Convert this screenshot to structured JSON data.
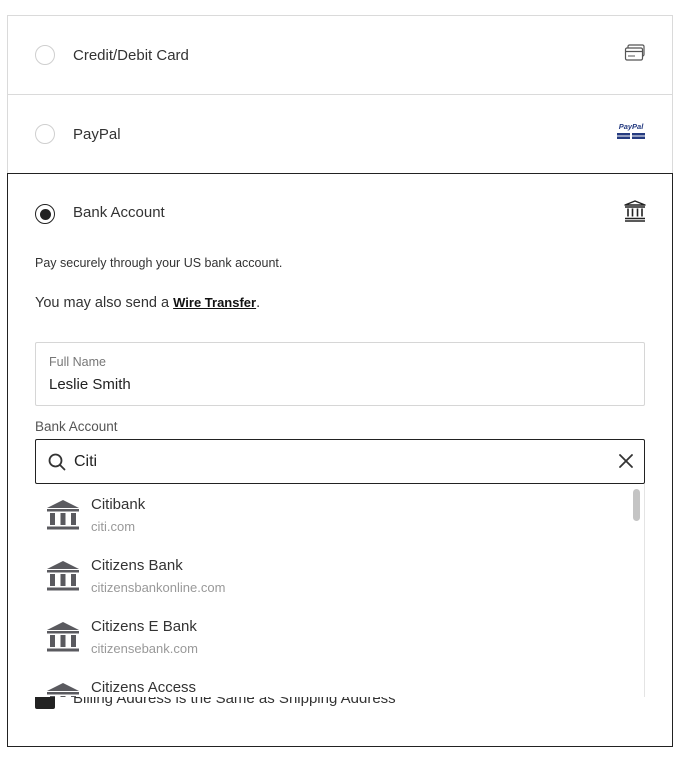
{
  "payment_options": {
    "card": {
      "label": "Credit/Debit Card",
      "icon": "credit-card-icon"
    },
    "paypal": {
      "label": "PayPal",
      "icon": "paypal-logo-icon",
      "logo_text": "PayPal"
    },
    "bank": {
      "label": "Bank Account",
      "icon": "bank-icon"
    }
  },
  "bank_panel": {
    "secure_text": "Pay securely through your US bank account.",
    "wire_prefix": "You may also send a ",
    "wire_link": "Wire Transfer",
    "wire_suffix": ".",
    "full_name": {
      "label": "Full Name",
      "value": "Leslie Smith"
    },
    "bank_account_label": "Bank Account",
    "search": {
      "value": "Citi",
      "placeholder": ""
    },
    "billing_same_text": "Billing Address is the Same as Shipping Address"
  },
  "bank_results": [
    {
      "name": "Citibank",
      "domain": "citi.com"
    },
    {
      "name": "Citizens Bank",
      "domain": "citizensbankonline.com"
    },
    {
      "name": "Citizens E Bank",
      "domain": "citizensebank.com"
    },
    {
      "name": "Citizens Access",
      "domain": ""
    }
  ],
  "colors": {
    "selected_border": "#222222",
    "divider": "#dadada",
    "bank_icon": "#5a5a5f",
    "paypal_blue": "#253b80"
  }
}
